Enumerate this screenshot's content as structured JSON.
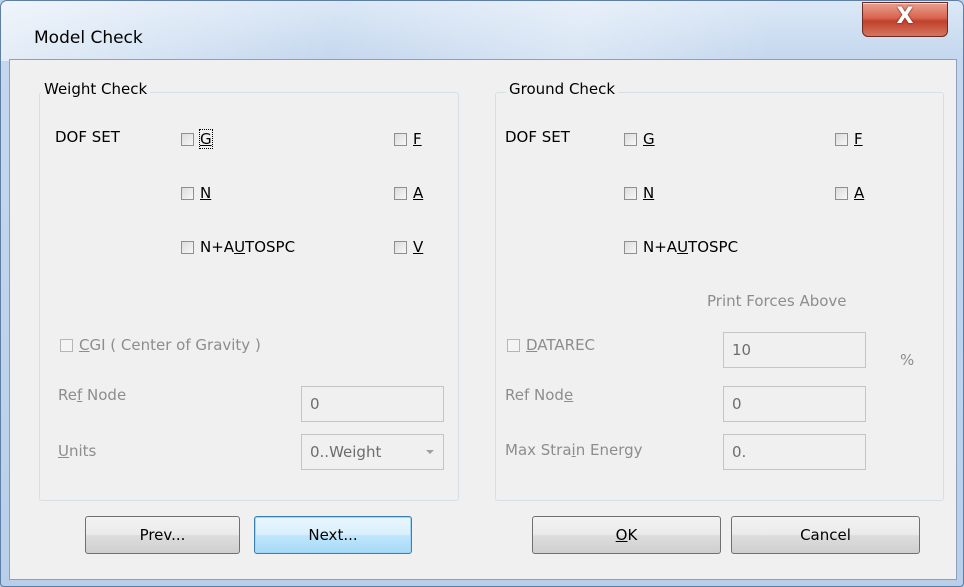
{
  "window": {
    "title": "Model Check",
    "close_glyph": "X"
  },
  "weight": {
    "group_title": "Weight Check",
    "dof_label": "DOF SET",
    "g": "G",
    "f": "F",
    "n": "N",
    "a": "A",
    "n_autospc_pre": "N+A",
    "n_autospc_u": "U",
    "n_autospc_post": "TOSPC",
    "v": "V",
    "cgi_u": "C",
    "cgi_rest": "GI ( Center of Gravity )",
    "refnode_pre": "Ref",
    "refnode_u": "",
    "refnode_post": " Node",
    "refnode_label_parts": [
      "Re",
      "f",
      " Node"
    ],
    "refnode_value": "0",
    "units_u": "U",
    "units_rest": "nits",
    "units_value": "0..Weight"
  },
  "ground": {
    "group_title": "Ground Check",
    "dof_label": "DOF SET",
    "g": "G",
    "f": "F",
    "n": "N",
    "a": "A",
    "n_autospc_pre": "N+A",
    "n_autospc_u": "U",
    "n_autospc_post": "TOSPC",
    "print_forces_label": "Print Forces Above",
    "datarec_u": "D",
    "datarec_rest": "ATAREC",
    "datarec_value": "10",
    "percent": "%",
    "refnode_label_parts": [
      "Ref Nod",
      "e",
      ""
    ],
    "refnode_value": "0",
    "maxstrain_label_parts": [
      "Max Stra",
      "i",
      "n Energy"
    ],
    "maxstrain_value": "0."
  },
  "buttons": {
    "prev": "Prev...",
    "next": "Next...",
    "ok_u": "O",
    "ok_rest": "K",
    "cancel": "Cancel"
  }
}
